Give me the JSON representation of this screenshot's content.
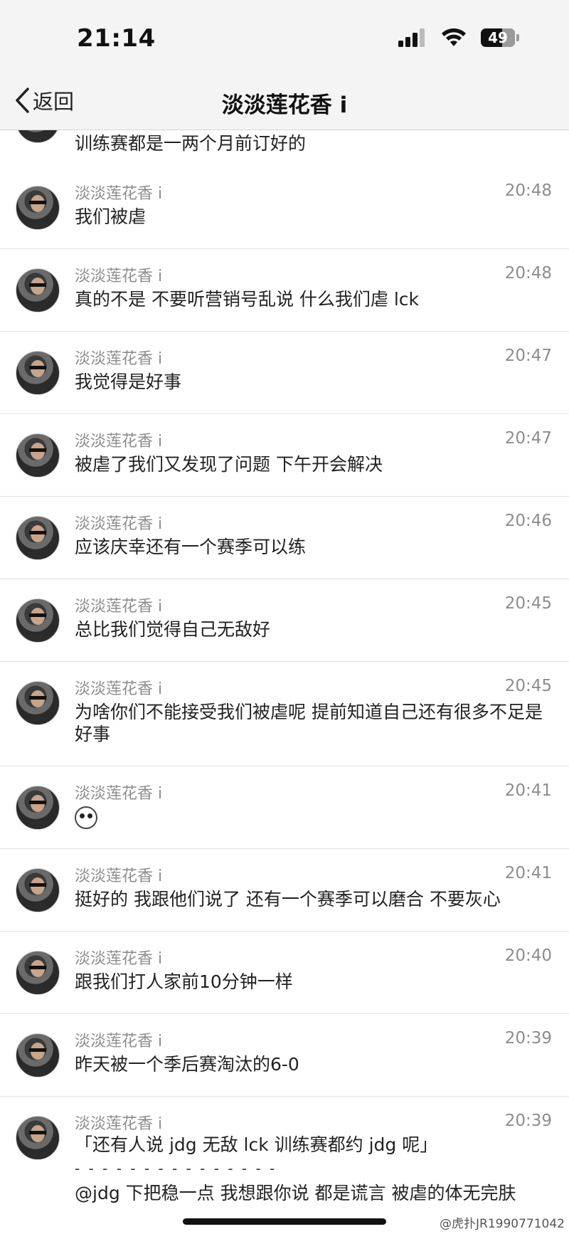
{
  "status_bar": {
    "time": "21:14",
    "battery": "49"
  },
  "nav": {
    "back_label": "返回",
    "title": "淡淡莲花香 i"
  },
  "messages": [
    {
      "sender": "",
      "time": "",
      "text": "训练赛都是一两个月前订好的"
    },
    {
      "sender": "淡淡莲花香 i",
      "time": "20:48",
      "text": "我们被虐"
    },
    {
      "sender": "淡淡莲花香 i",
      "time": "20:48",
      "text": "真的不是 不要听营销号乱说 什么我们虐 lck"
    },
    {
      "sender": "淡淡莲花香 i",
      "time": "20:47",
      "text": "我觉得是好事"
    },
    {
      "sender": "淡淡莲花香 i",
      "time": "20:47",
      "text": "被虐了我们又发现了问题 下午开会解决"
    },
    {
      "sender": "淡淡莲花香 i",
      "time": "20:46",
      "text": "应该庆幸还有一个赛季可以练"
    },
    {
      "sender": "淡淡莲花香 i",
      "time": "20:45",
      "text": "总比我们觉得自己无敌好"
    },
    {
      "sender": "淡淡莲花香 i",
      "time": "20:45",
      "text": "为啥你们不能接受我们被虐呢 提前知道自己还有很多不足是好事"
    },
    {
      "sender": "淡淡莲花香 i",
      "time": "20:41",
      "text": "",
      "emoji": "face-emoji"
    },
    {
      "sender": "淡淡莲花香 i",
      "time": "20:41",
      "text": "挺好的 我跟他们说了 还有一个赛季可以磨合 不要灰心"
    },
    {
      "sender": "淡淡莲花香 i",
      "time": "20:40",
      "text": "跟我们打人家前10分钟一样"
    },
    {
      "sender": "淡淡莲花香 i",
      "time": "20:39",
      "text": "昨天被一个季后赛淘汰的6-0"
    },
    {
      "sender": "淡淡莲花香 i",
      "time": "20:39",
      "quote": "「还有人说 jdg 无敌 lck 训练赛都约 jdg 呢」",
      "separator": "- - - - - - - - - - - - - - -",
      "text": "@jdg 下把稳一点 我想跟你说 都是谎言 被虐的体无完肤"
    }
  ],
  "watermark": "@虎扑JR1990771042"
}
